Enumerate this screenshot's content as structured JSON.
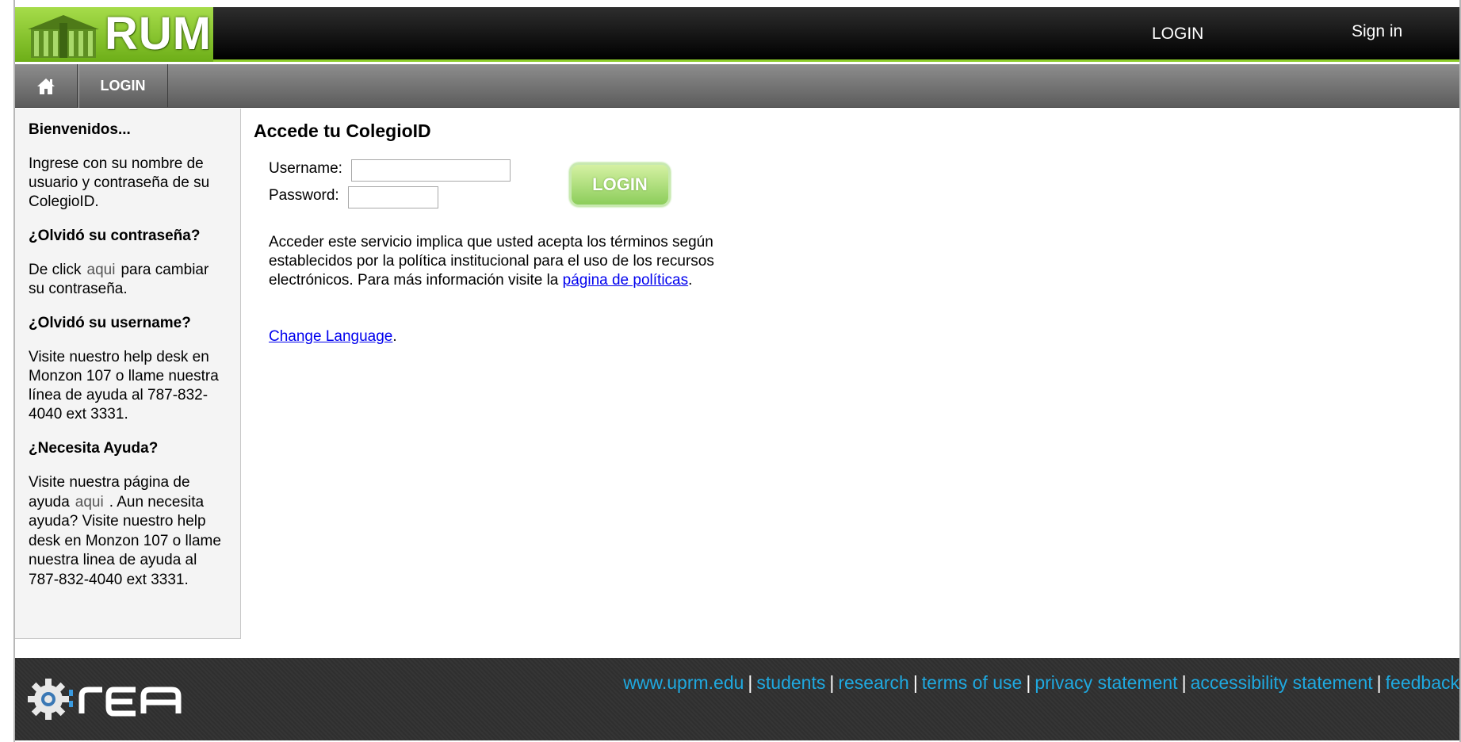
{
  "header": {
    "logo_text": "RUM",
    "login_link": "LOGIN",
    "signin_link": "Sign in"
  },
  "nav": {
    "home_icon": "home-icon",
    "login_tab": "LOGIN"
  },
  "sidebar": {
    "welcome_title": "Bienvenidos...",
    "welcome_text": "Ingrese con su nombre de usuario y contraseña de su ColegioID.",
    "forgot_password_title": "¿Olvidó su contraseña?",
    "forgot_password_pre": "De click",
    "forgot_password_link": "aqui",
    "forgot_password_post": "para cambiar su contraseña.",
    "forgot_username_title": "¿Olvidó su username?",
    "forgot_username_text": "Visite nuestro help desk en Monzon 107 o llame nuestra línea de ayuda al 787-832-4040 ext 3331.",
    "help_title": "¿Necesita Ayuda?",
    "help_pre": "Visite nuestra página de ayuda",
    "help_link": "aqui",
    "help_post": ". Aun necesita ayuda? Visite nuestro help desk en Monzon 107 o llame nuestra linea de ayuda al 787-832-4040 ext 3331."
  },
  "main": {
    "title": "Accede tu ColegioID",
    "username_label": "Username:",
    "username_value": "",
    "password_label": "Password:",
    "password_value": "",
    "login_button": "LOGIN",
    "terms_text": "Acceder este servicio implica que usted acepta los términos según establecidos por la política institucional para el uso de los recursos electrónicos. Para más información visite la ",
    "terms_link": "página de políticas",
    "terms_end": ".",
    "change_language_link": "Change Language",
    "change_language_end": "."
  },
  "footer": {
    "logo_text": "REA",
    "links": [
      "www.uprm.edu",
      "students",
      "research",
      "terms of use",
      "privacy statement",
      "accessibility statement",
      "feedback"
    ],
    "separator": "|"
  },
  "colors": {
    "accent_green": "#8ccc2a",
    "footer_link": "#1fa9e0",
    "link": "#0000ee"
  }
}
